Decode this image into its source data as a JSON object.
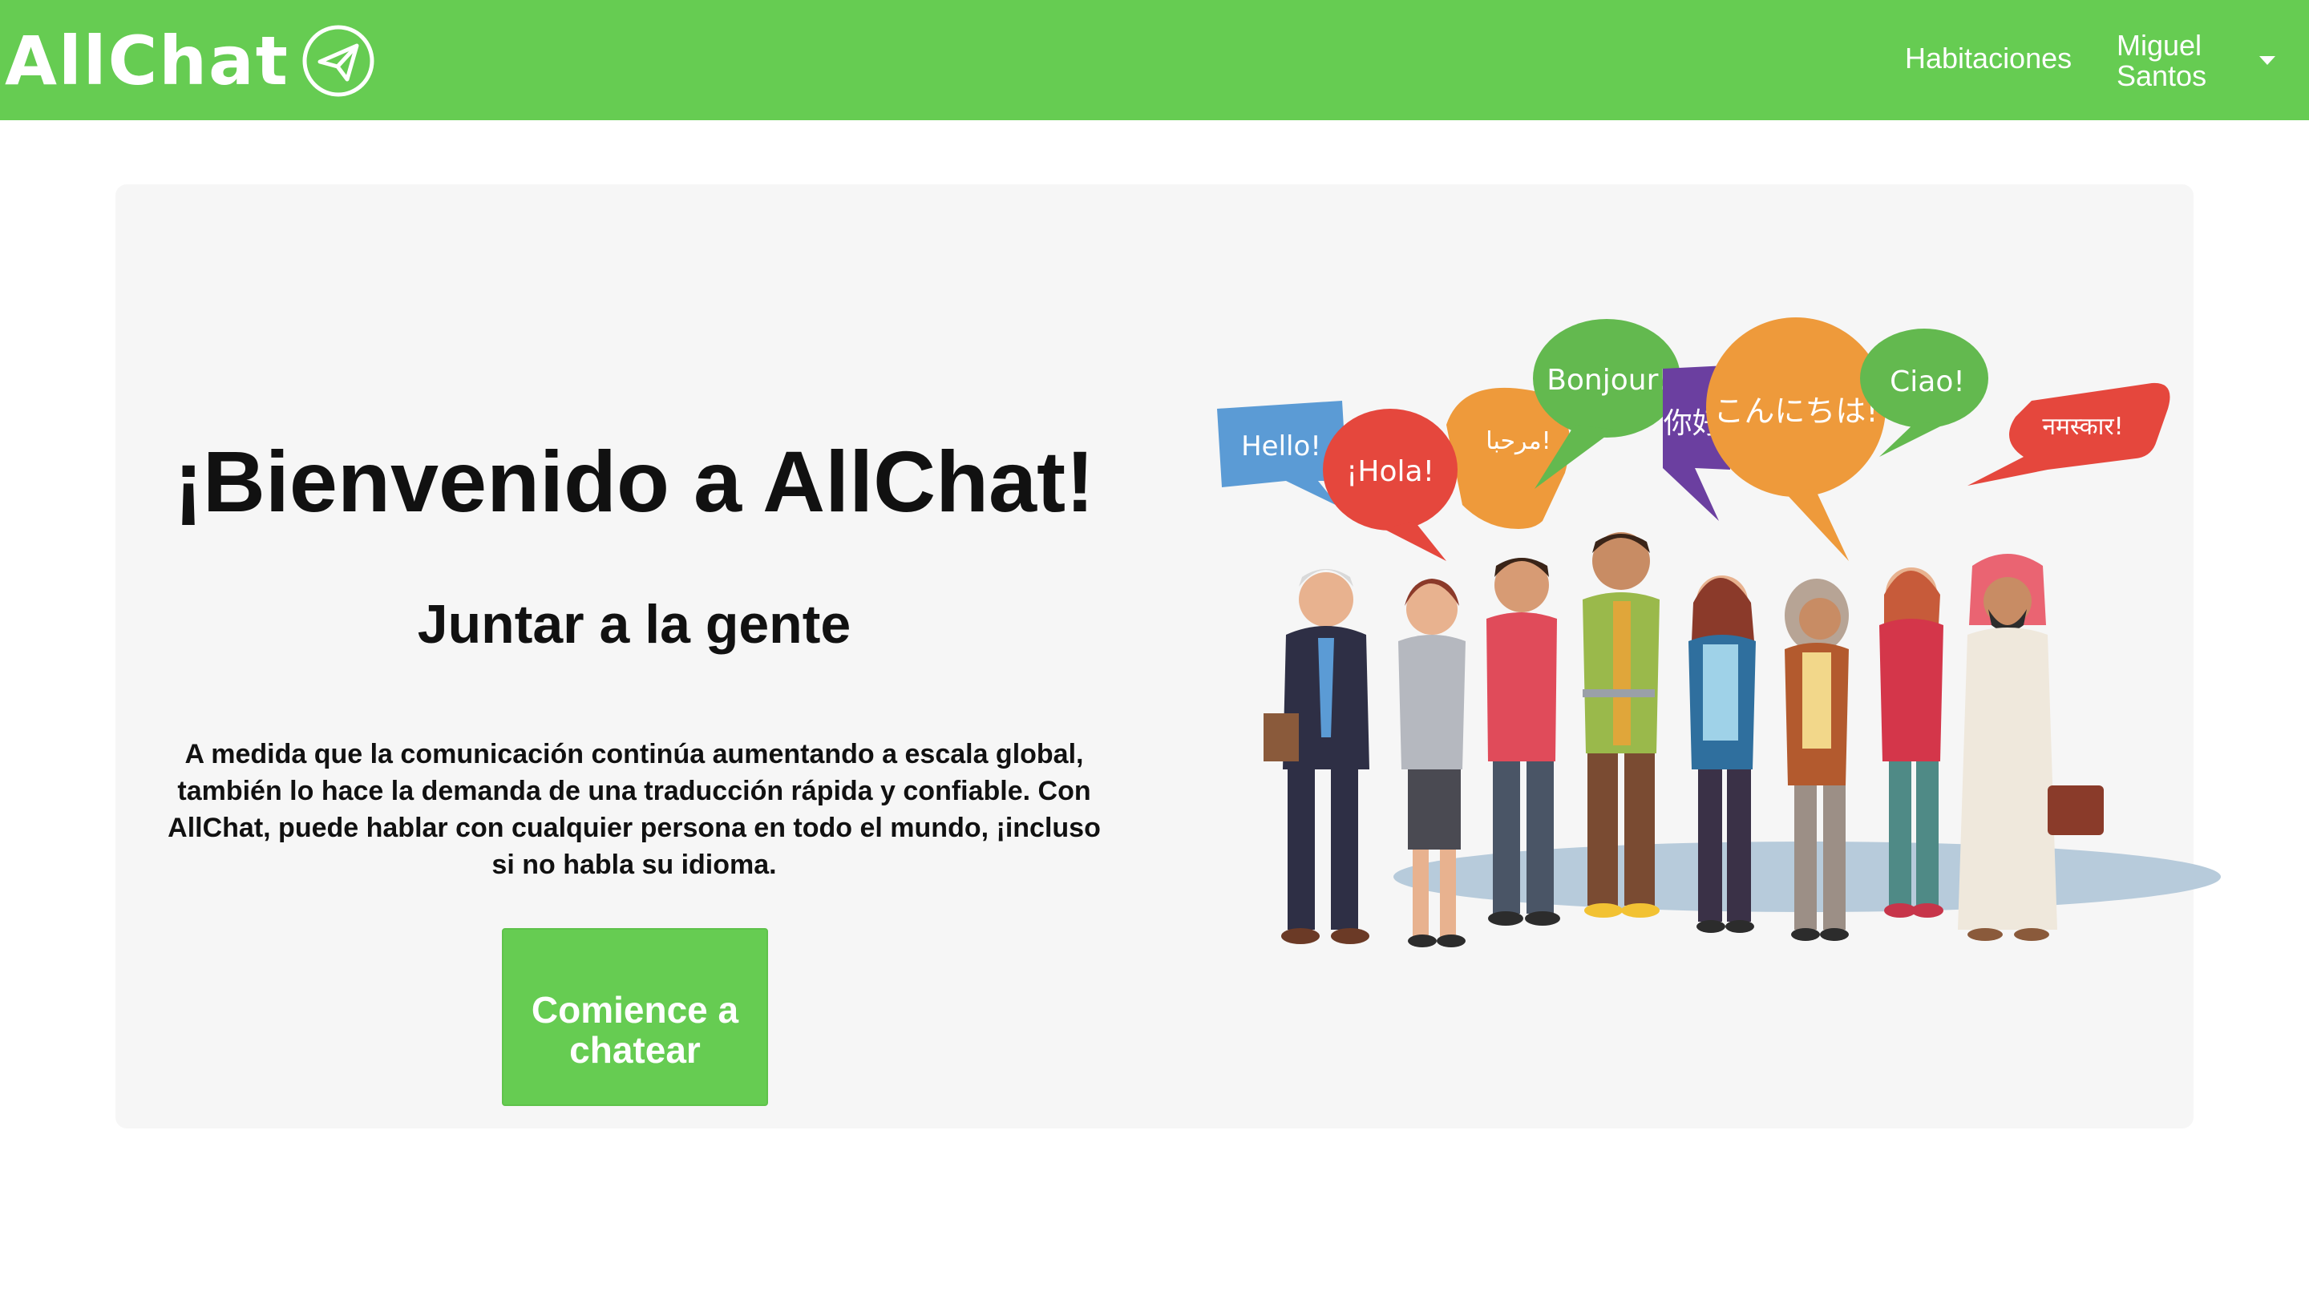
{
  "app": {
    "brand_name": "AllChat",
    "brand_icon": "paper-plane-icon",
    "accent_color": "#66cc52"
  },
  "nav": {
    "rooms_label": "Habitaciones",
    "user_name": "Miguel Santos",
    "user_menu_icon": "chevron-down-icon"
  },
  "hero": {
    "title": "¡Bienvenido a AllChat!",
    "subtitle": "Juntar a la gente",
    "body": "A medida que la comunicación continúa aumentando a escala global, también lo hace la demanda de una traducción rápida y confiable. Con AllChat, puede hablar con cualquier persona en todo el mundo, ¡incluso si no habla su idioma.",
    "cta_label": "Comience a chatear"
  },
  "illustration": {
    "bubbles": [
      {
        "text": "Hello!",
        "color": "#5b9bd5"
      },
      {
        "text": "¡Hola!",
        "color": "#e5473d"
      },
      {
        "text": "مرحبا!",
        "color": "#ee9a3b"
      },
      {
        "text": "Bonjour!",
        "color": "#63b94f"
      },
      {
        "text": "你好!",
        "color": "#6b3fa0"
      },
      {
        "text": "こんにちは!",
        "color": "#ee9a3b"
      },
      {
        "text": "Ciao!",
        "color": "#63b94f"
      },
      {
        "text": "नमस्कार!",
        "color": "#e5473d"
      }
    ]
  }
}
